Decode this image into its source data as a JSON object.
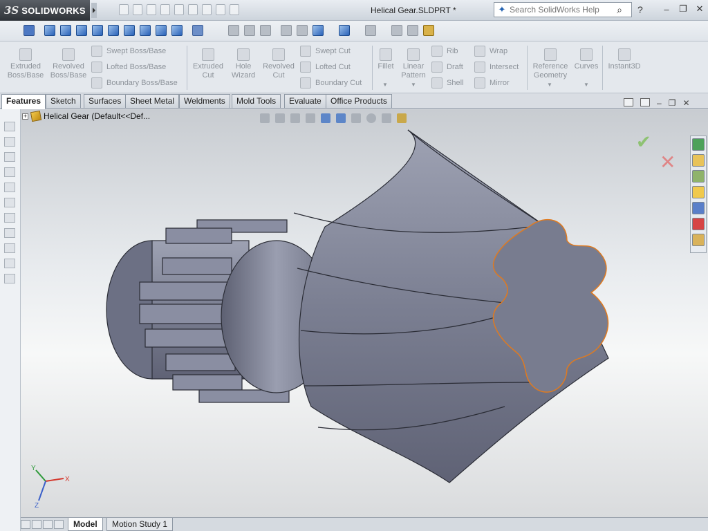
{
  "app": {
    "logo_prefix": "3S",
    "logo_name": "SOLIDWORKS"
  },
  "document": {
    "title": "Helical Gear.SLDPRT *"
  },
  "search": {
    "placeholder": "Search SolidWorks Help"
  },
  "commands": {
    "extruded_boss": "Extruded\nBoss/Base",
    "revolved_boss": "Revolved\nBoss/Base",
    "swept_boss": "Swept Boss/Base",
    "lofted_boss": "Lofted Boss/Base",
    "boundary_boss": "Boundary Boss/Base",
    "extruded_cut": "Extruded\nCut",
    "hole_wizard": "Hole\nWizard",
    "revolved_cut": "Revolved\nCut",
    "swept_cut": "Swept Cut",
    "lofted_cut": "Lofted Cut",
    "boundary_cut": "Boundary Cut",
    "fillet": "Fillet",
    "linear_pattern": "Linear\nPattern",
    "rib": "Rib",
    "draft": "Draft",
    "shell": "Shell",
    "wrap": "Wrap",
    "intersect": "Intersect",
    "mirror": "Mirror",
    "reference_geometry": "Reference\nGeometry",
    "curves": "Curves",
    "instant3d": "Instant3D"
  },
  "tabs": [
    "Features",
    "Sketch",
    "Surfaces",
    "Sheet Metal",
    "Weldments",
    "Mold Tools",
    "Evaluate",
    "Office Products"
  ],
  "tree": {
    "label": "Helical Gear  (Default<<Def..."
  },
  "bottom_tabs": [
    "Model",
    "Motion Study 1"
  ],
  "triad": {
    "x": "X",
    "y": "Y",
    "z": "Z"
  },
  "colors": {
    "accent": "#1f5fb0",
    "part": "#7a7e8c",
    "selection": "#e07a1f"
  }
}
